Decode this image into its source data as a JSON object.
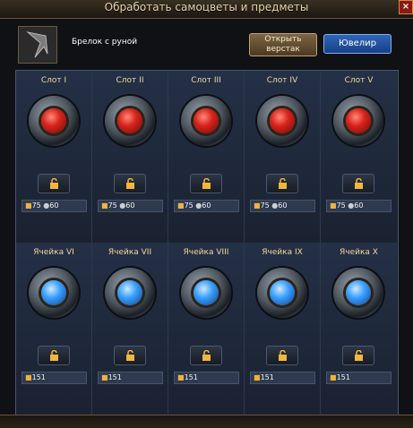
{
  "window": {
    "title": "Обработать самоцветы и предметы",
    "close_label": "×"
  },
  "item": {
    "name": "Брелок с руной"
  },
  "buttons": {
    "workbench_line1": "Открыть",
    "workbench_line2": "верстак",
    "jeweler": "Ювелир"
  },
  "icons": {
    "coin": "coin-icon",
    "gear": "gear-icon",
    "lock": "unlock-icon"
  },
  "slots_top": [
    {
      "label": "Слот I",
      "cost_gold": "75",
      "cost_other": "60"
    },
    {
      "label": "Слот II",
      "cost_gold": "75",
      "cost_other": "60"
    },
    {
      "label": "Слот III",
      "cost_gold": "75",
      "cost_other": "60"
    },
    {
      "label": "Слот IV",
      "cost_gold": "75",
      "cost_other": "60"
    },
    {
      "label": "Слот V",
      "cost_gold": "75",
      "cost_other": "60"
    }
  ],
  "slots_bottom": [
    {
      "label": "Ячейка VI",
      "cost_gold": "151"
    },
    {
      "label": "Ячейка VII",
      "cost_gold": "151"
    },
    {
      "label": "Ячейка VIII",
      "cost_gold": "151"
    },
    {
      "label": "Ячейка IX",
      "cost_gold": "151"
    },
    {
      "label": "Ячейка X",
      "cost_gold": "151"
    }
  ]
}
